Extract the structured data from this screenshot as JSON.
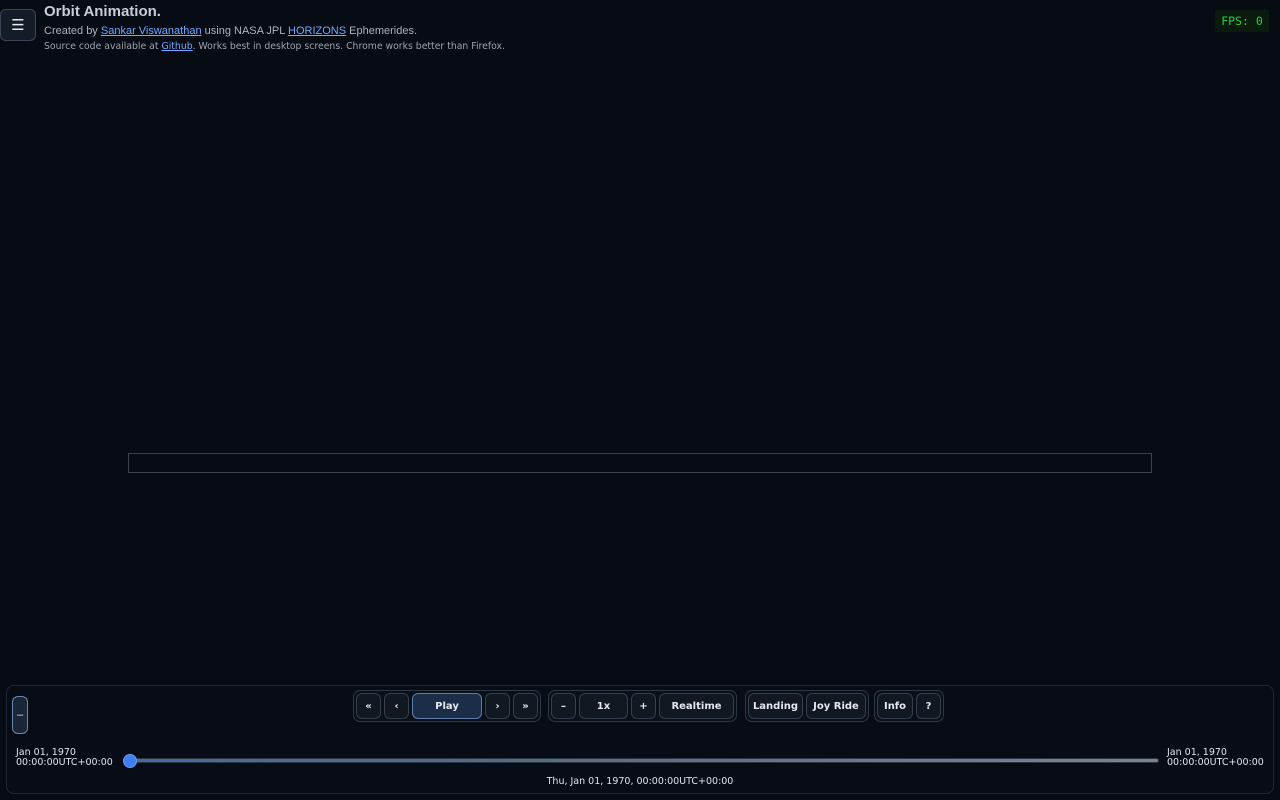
{
  "menu": {
    "icon": "☰"
  },
  "header": {
    "title": "Orbit Animation.",
    "credit_prefix": "Created by",
    "author_link": "Sankar Viswanathan",
    "credit_mid": "using NASA JPL",
    "horizons_link": "HORIZONS",
    "credit_suffix": "Ephemerides.",
    "source_prefix": "Source code available at",
    "github_link": "Github",
    "source_suffix": ". Works best in desktop screens. Chrome works better than Firefox."
  },
  "fps": {
    "text": "FPS: 0"
  },
  "controls": {
    "collapse_label": "–",
    "nav": {
      "first": "«",
      "prev": "‹",
      "play": "Play",
      "next": "›",
      "last": "»"
    },
    "speed": {
      "decrease": "–",
      "value": "1x",
      "increase": "+",
      "realtime": "Realtime"
    },
    "views": {
      "landing": "Landing",
      "joyride": "Joy Ride"
    },
    "help": {
      "info": "Info",
      "question": "?"
    }
  },
  "timeline": {
    "start_date": "Jan 01, 1970",
    "start_time": "00:00:00UTC+00:00",
    "end_date": "Jan 01, 1970",
    "end_time": "00:00:00UTC+00:00",
    "position": 0,
    "current": "Thu, Jan 01, 1970, 00:00:00UTC+00:00"
  }
}
